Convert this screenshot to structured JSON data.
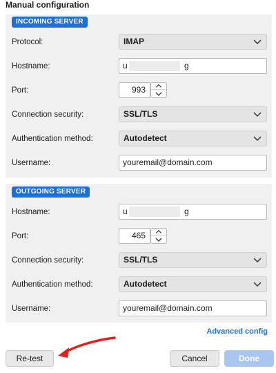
{
  "dialog": {
    "title": "Manual configuration"
  },
  "incoming": {
    "badge": "INCOMING SERVER",
    "protocol_label": "Protocol:",
    "protocol_value": "IMAP",
    "hostname_label": "Hostname:",
    "hostname_start": "u",
    "hostname_end": "g",
    "port_label": "Port:",
    "port_value": "993",
    "security_label": "Connection security:",
    "security_value": "SSL/TLS",
    "auth_label": "Authentication method:",
    "auth_value": "Autodetect",
    "username_label": "Username:",
    "username_value": "youremail@domain.com"
  },
  "outgoing": {
    "badge": "OUTGOING SERVER",
    "hostname_label": "Hostname:",
    "hostname_start": "u",
    "hostname_end": "g",
    "port_label": "Port:",
    "port_value": "465",
    "security_label": "Connection security:",
    "security_value": "SSL/TLS",
    "auth_label": "Authentication method:",
    "auth_value": "Autodetect",
    "username_label": "Username:",
    "username_value": "youremail@domain.com"
  },
  "links": {
    "advanced": "Advanced config"
  },
  "buttons": {
    "retest": "Re-test",
    "cancel": "Cancel",
    "done": "Done"
  },
  "colors": {
    "accent": "#1f6fd6",
    "arrow": "#e0201b",
    "done_disabled": "#a9c6ef"
  },
  "icons": {
    "select_chevron": "chevron-down-icon",
    "stepper": "stepper-arrows-icon",
    "annotation": "red-arrow-icon"
  }
}
